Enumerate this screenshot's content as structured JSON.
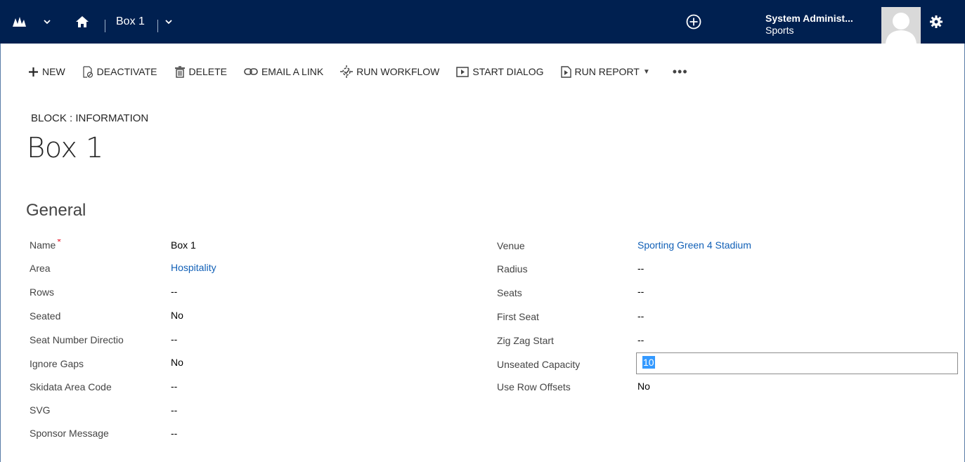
{
  "nav": {
    "record_title": "Box 1",
    "user_name": "System Administ...",
    "user_org": "Sports"
  },
  "commands": [
    {
      "label": "NEW",
      "icon": "plus-icon"
    },
    {
      "label": "DEACTIVATE",
      "icon": "deactivate-icon"
    },
    {
      "label": "DELETE",
      "icon": "trash-icon"
    },
    {
      "label": "EMAIL A LINK",
      "icon": "link-icon"
    },
    {
      "label": "RUN WORKFLOW",
      "icon": "workflow-icon"
    },
    {
      "label": "START DIALOG",
      "icon": "dialog-icon"
    },
    {
      "label": "RUN REPORT",
      "icon": "report-icon"
    }
  ],
  "header": {
    "entity_label": "BLOCK : INFORMATION",
    "title": "Box 1"
  },
  "section": {
    "title": "General"
  },
  "left_fields": [
    {
      "label": "Name",
      "value": "Box 1",
      "required": "*"
    },
    {
      "label": "Area",
      "value": "Hospitality"
    },
    {
      "label": "Rows",
      "value": "--"
    },
    {
      "label": "Seated",
      "value": "No"
    },
    {
      "label": "Seat Number Directio",
      "value": "--"
    },
    {
      "label": "Ignore Gaps",
      "value": "No"
    },
    {
      "label": "Skidata Area Code",
      "value": "--"
    },
    {
      "label": "SVG",
      "value": "--"
    },
    {
      "label": "Sponsor Message",
      "value": "--"
    }
  ],
  "right_fields": [
    {
      "label": "Venue",
      "value": "Sporting Green 4 Stadium"
    },
    {
      "label": "Radius",
      "value": "--"
    },
    {
      "label": "Seats",
      "value": "--"
    },
    {
      "label": "First Seat",
      "value": "--"
    },
    {
      "label": "Zig Zag Start",
      "value": "--"
    },
    {
      "label": "Unseated Capacity",
      "value": "10"
    },
    {
      "label": "Use Row Offsets",
      "value": "No"
    }
  ],
  "colors": {
    "navbar": "#002050",
    "link": "#1160b7",
    "required": "#e81123",
    "selection": "#3399ff"
  }
}
